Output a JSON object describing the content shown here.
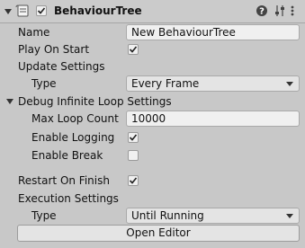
{
  "header": {
    "title": "BehaviourTree",
    "enabled": true,
    "icons": [
      "component-foldout-icon",
      "script-icon",
      "help-icon",
      "sliders-icon",
      "more-icon"
    ]
  },
  "fields": {
    "name": {
      "label": "Name",
      "value": "New BehaviourTree"
    },
    "play_on_start": {
      "label": "Play On Start",
      "checked": true
    },
    "update_settings": {
      "label": "Update Settings",
      "type_label": "Type",
      "type_value": "Every Frame"
    },
    "debug": {
      "label": "Debug Infinite Loop Settings",
      "expanded": true,
      "max_loop_label": "Max Loop Count",
      "max_loop_value": "10000",
      "enable_logging_label": "Enable Logging",
      "enable_logging": true,
      "enable_break_label": "Enable Break",
      "enable_break": false
    },
    "restart_on_finish": {
      "label": "Restart On Finish",
      "checked": true
    },
    "execution_settings": {
      "label": "Execution Settings",
      "type_label": "Type",
      "type_value": "Until Running"
    }
  },
  "buttons": {
    "open_editor": "Open Editor"
  },
  "colors": {
    "panel_bg": "#c8c8c8",
    "field_bg": "#f0f0f0",
    "text": "#111111"
  }
}
